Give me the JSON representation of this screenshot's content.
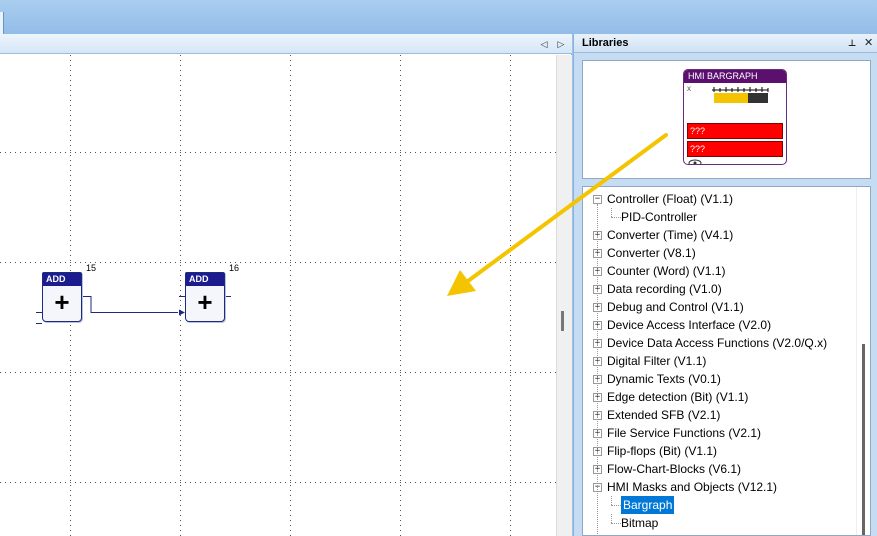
{
  "canvas": {
    "nav_left": "◁",
    "nav_right": "▷",
    "blocks": [
      {
        "label": "ADD",
        "symbol": "+",
        "number": "15"
      },
      {
        "label": "ADD",
        "symbol": "+",
        "number": "16"
      }
    ]
  },
  "libraries": {
    "title": "Libraries",
    "pin_icon": "pin-icon",
    "close_icon": "close-icon",
    "pin_glyph": "📌",
    "close_glyph": "✕",
    "preview": {
      "block_title": "HMI BARGRAPH",
      "x_marker": "x",
      "output1": "???",
      "output2": "???"
    },
    "tree": [
      {
        "label": "Controller (Float) (V1.1)",
        "expander": "−",
        "child": false
      },
      {
        "label": "PID-Controller",
        "expander": "",
        "child": true
      },
      {
        "label": "Converter (Time) (V4.1)",
        "expander": "+",
        "child": false
      },
      {
        "label": "Converter (V8.1)",
        "expander": "+",
        "child": false
      },
      {
        "label": "Counter (Word) (V1.1)",
        "expander": "+",
        "child": false
      },
      {
        "label": "Data recording (V1.0)",
        "expander": "+",
        "child": false
      },
      {
        "label": "Debug and Control (V1.1)",
        "expander": "+",
        "child": false
      },
      {
        "label": "Device Access Interface (V2.0)",
        "expander": "+",
        "child": false
      },
      {
        "label": "Device Data Access Functions (V2.0/Q.x)",
        "expander": "+",
        "child": false
      },
      {
        "label": "Digital Filter (V1.1)",
        "expander": "+",
        "child": false
      },
      {
        "label": "Dynamic Texts (V0.1)",
        "expander": "+",
        "child": false
      },
      {
        "label": "Edge detection (Bit) (V1.1)",
        "expander": "+",
        "child": false
      },
      {
        "label": "Extended SFB (V2.1)",
        "expander": "+",
        "child": false
      },
      {
        "label": "File Service Functions (V2.1)",
        "expander": "+",
        "child": false
      },
      {
        "label": "Flip-flops (Bit) (V1.1)",
        "expander": "+",
        "child": false
      },
      {
        "label": "Flow-Chart-Blocks (V6.1)",
        "expander": "+",
        "child": false
      },
      {
        "label": "HMI Masks and Objects (V12.1)",
        "expander": "−",
        "child": false
      },
      {
        "label": "Bargraph",
        "expander": "",
        "child": true,
        "selected": true
      },
      {
        "label": "Bitmap",
        "expander": "",
        "child": true
      }
    ]
  },
  "colors": {
    "block_header": "#1c1c8e",
    "hmi_header": "#5b0f6e",
    "hmi_output": "#ff0000",
    "arrow": "#f5c400",
    "selection": "#0078d7"
  }
}
